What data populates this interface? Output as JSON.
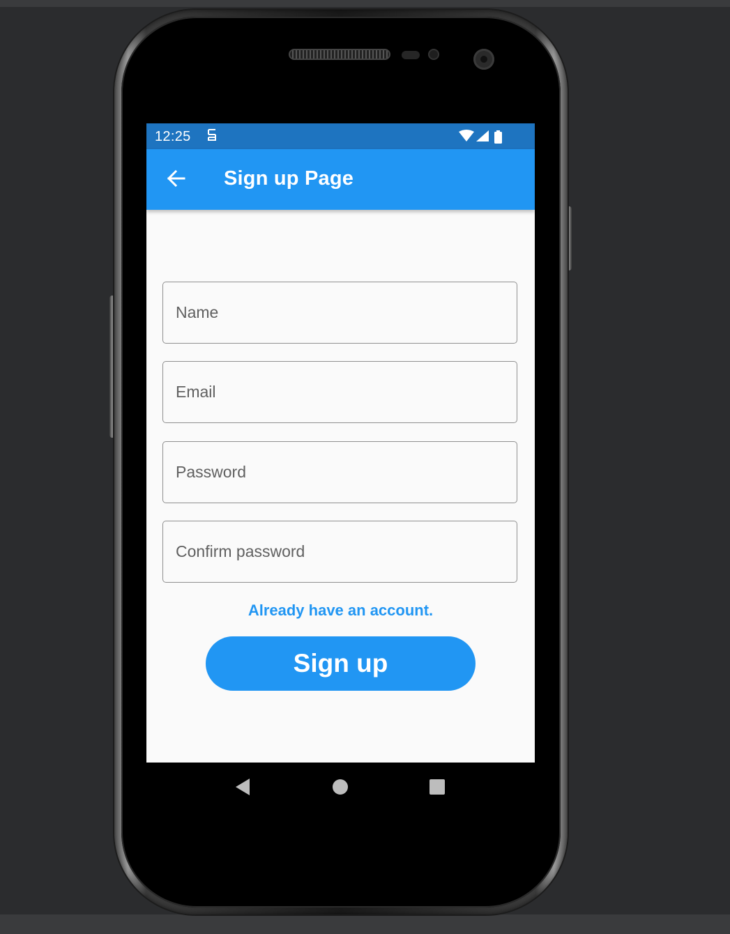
{
  "status_bar": {
    "time": "12:25",
    "notification_icon": "sim-card-icon",
    "icons": [
      "wifi-icon",
      "signal-icon",
      "battery-icon"
    ]
  },
  "app_bar": {
    "title": "Sign up Page",
    "back_icon": "arrow-back-icon"
  },
  "form": {
    "name_placeholder": "Name",
    "email_placeholder": "Email",
    "password_placeholder": "Password",
    "confirm_password_placeholder": "Confirm password",
    "login_link": "Already have an account.",
    "submit_label": "Sign up"
  },
  "navigation": {
    "back": "nav-back-icon",
    "home": "nav-home-icon",
    "recents": "nav-recents-icon"
  },
  "colors": {
    "primary": "#2196f3",
    "status_bar": "#1e74c0",
    "background": "#fafafa"
  }
}
